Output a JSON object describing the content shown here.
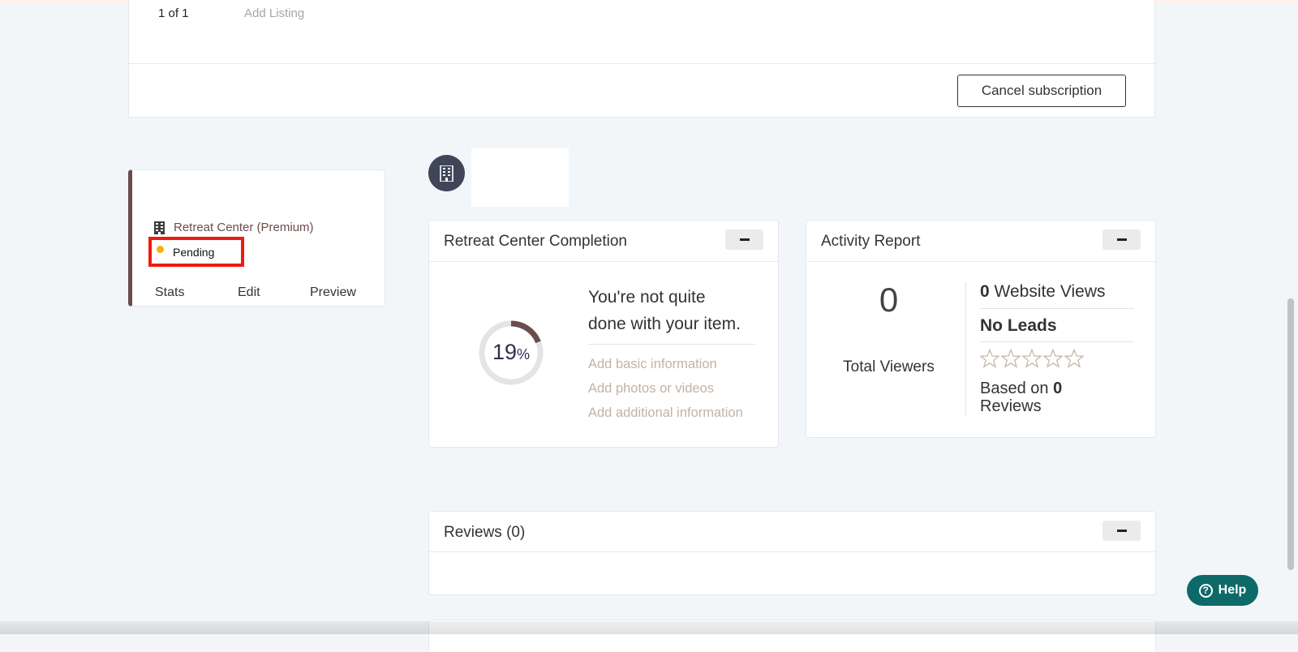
{
  "subscription": {
    "pager": "1 of 1",
    "add_listing": "Add Listing",
    "cancel_label": "Cancel subscription"
  },
  "listing": {
    "type_label": "Retreat Center (Premium)",
    "status": "Pending",
    "status_color": "#f5b10d",
    "accent_color": "#6e4b4b",
    "actions": [
      "Stats",
      "Edit",
      "Preview"
    ]
  },
  "completion": {
    "title": "Retreat Center Completion",
    "percent_value": 19,
    "percent_number": "19",
    "percent_sign": "%",
    "message_line1": "You're not quite",
    "message_line2": "done with your item.",
    "todos": [
      "Add basic information",
      "Add photos or videos",
      "Add additional information"
    ]
  },
  "activity": {
    "title": "Activity Report",
    "total_viewers_count": "0",
    "total_viewers_label": "Total Viewers",
    "website_views_count": "0",
    "website_views_label": "Website Views",
    "leads_label": "No Leads",
    "rating_stars": 0,
    "rating_max": 5,
    "based_on_prefix": "Based on",
    "reviews_count": "0",
    "reviews_label": "Reviews"
  },
  "reviews_panel": {
    "title": "Reviews (0)"
  },
  "help": {
    "label": "Help"
  },
  "icons": {
    "listing_type": "building-icon",
    "avatar": "building-icon",
    "collapse": "minus-icon",
    "help": "question-circle-icon",
    "rating": "star-outline-icon"
  }
}
